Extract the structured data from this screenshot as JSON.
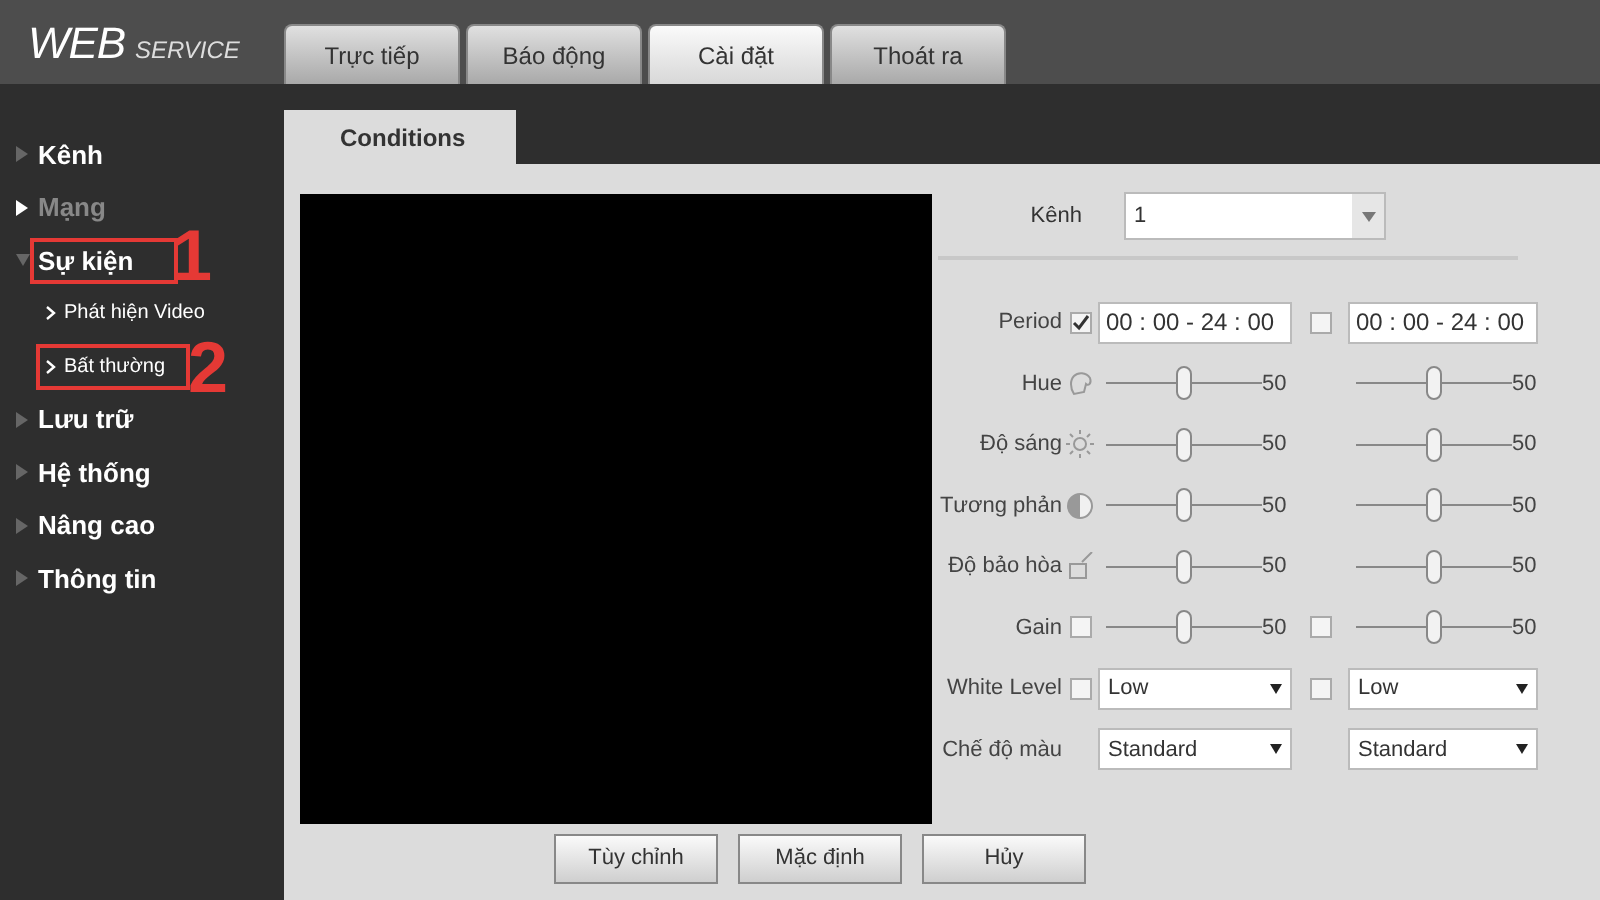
{
  "logo": {
    "main": "WEB",
    "sub": "SERVICE"
  },
  "tabs": [
    {
      "label": "Trực tiếp",
      "selected": false
    },
    {
      "label": "Báo động",
      "selected": false
    },
    {
      "label": "Cài đặt",
      "selected": true
    },
    {
      "label": "Thoát ra",
      "selected": false
    }
  ],
  "sidebar": {
    "items": [
      {
        "label": "Kênh",
        "dimmed": false,
        "expanded": false,
        "highlighted": false
      },
      {
        "label": "Mạng",
        "dimmed": true,
        "expanded": false,
        "highlighted": false
      },
      {
        "label": "Sự kiện",
        "dimmed": false,
        "expanded": true,
        "highlighted": true,
        "children": [
          {
            "label": "Phát hiện Video",
            "highlighted": false
          },
          {
            "label": "Bất thường",
            "highlighted": true
          }
        ]
      },
      {
        "label": "Lưu trữ",
        "dimmed": false,
        "expanded": false,
        "highlighted": false
      },
      {
        "label": "Hệ thống",
        "dimmed": false,
        "expanded": false,
        "highlighted": false
      },
      {
        "label": "Nâng cao",
        "dimmed": false,
        "expanded": false,
        "highlighted": false
      },
      {
        "label": "Thông tin",
        "dimmed": false,
        "expanded": false,
        "highlighted": false
      }
    ]
  },
  "annotations": [
    "1",
    "2"
  ],
  "subtab": "Conditions",
  "channel": {
    "label": "Kênh",
    "value": "1"
  },
  "rows": [
    {
      "kind": "period",
      "label": "Period",
      "columns": [
        {
          "checked": true,
          "value": "00 : 00 - 24 : 00"
        },
        {
          "checked": false,
          "value": "00 : 00 - 24 : 00"
        }
      ]
    },
    {
      "kind": "slider",
      "label": "Hue",
      "columns": [
        {
          "level": 0.5,
          "reading": "50"
        },
        {
          "level": 0.5,
          "reading": "50"
        }
      ]
    },
    {
      "kind": "slider",
      "label": "Độ sáng",
      "columns": [
        {
          "level": 0.5,
          "reading": "50"
        },
        {
          "level": 0.5,
          "reading": "50"
        }
      ]
    },
    {
      "kind": "slider",
      "label": "Tương phản",
      "columns": [
        {
          "level": 0.5,
          "reading": "50"
        },
        {
          "level": 0.5,
          "reading": "50"
        }
      ]
    },
    {
      "kind": "slider",
      "label": "Độ bảo hòa",
      "columns": [
        {
          "level": 0.5,
          "reading": "50"
        },
        {
          "level": 0.5,
          "reading": "50"
        }
      ]
    },
    {
      "kind": "slider",
      "label": "Gain",
      "columns": [
        {
          "checked": false,
          "level": 0.5,
          "reading": "50"
        },
        {
          "checked": false,
          "level": 0.5,
          "reading": "50"
        }
      ]
    },
    {
      "kind": "select",
      "label": "White Level",
      "columns": [
        {
          "checked": false,
          "value": "Low"
        },
        {
          "checked": false,
          "value": "Low"
        }
      ]
    },
    {
      "kind": "select",
      "label": "Chế độ màu",
      "columns": [
        {
          "value": "Standard"
        },
        {
          "value": "Standard"
        }
      ]
    }
  ],
  "buttons": [
    "Tùy chỉnh",
    "Mặc định",
    "Hủy"
  ]
}
